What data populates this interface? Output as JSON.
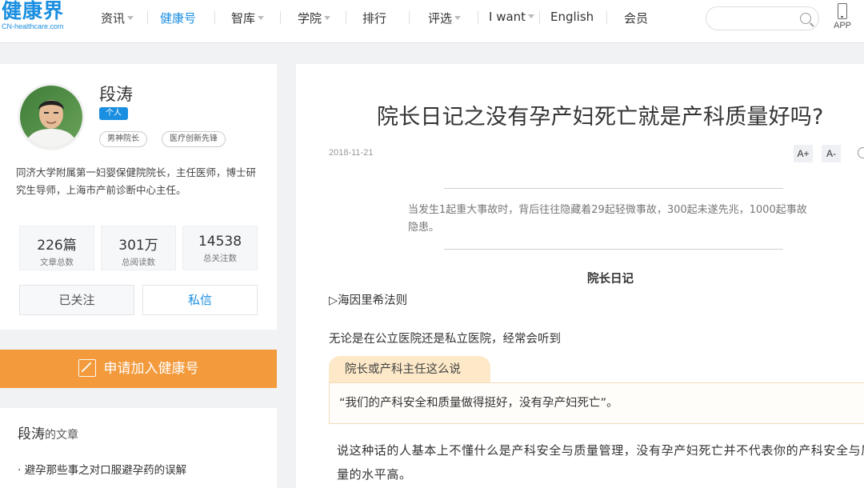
{
  "header": {
    "logo_text": "健康界",
    "logo_sub": "CN-healthcare.com",
    "nav": [
      {
        "label": "资讯",
        "dropdown": true
      },
      {
        "label": "健康号",
        "dropdown": false,
        "active": true
      },
      {
        "label": "智库",
        "dropdown": true
      },
      {
        "label": "学院",
        "dropdown": true
      },
      {
        "label": "排行",
        "dropdown": false
      },
      {
        "label": "评选",
        "dropdown": true
      },
      {
        "label": "I want",
        "dropdown": true
      },
      {
        "label": "English",
        "dropdown": false
      },
      {
        "label": "会员",
        "dropdown": false
      }
    ],
    "search_placeholder": "",
    "app_label": "APP"
  },
  "author": {
    "name": "段涛",
    "badge": "个人",
    "tags": [
      "男神院长",
      "医疗创新先锋"
    ],
    "bio": "同济大学附属第一妇婴保健院院长，主任医师，博士研究生导师，上海市产前诊断中心主任。",
    "stats": [
      {
        "value": "226篇",
        "label": "文章总数"
      },
      {
        "value": "301万",
        "label": "总阅读数"
      },
      {
        "value": "14538",
        "label": "总关注数"
      }
    ],
    "follow_label": "已关注",
    "message_label": "私信"
  },
  "join_label": "申请加入健康号",
  "articles": {
    "name": "段涛",
    "suffix": "的文章",
    "items": [
      "· 避孕那些事之对口服避孕药的误解"
    ]
  },
  "article": {
    "title": "院长日记之没有孕产妇死亡就是产科质量好吗?",
    "date": "2018-11-21",
    "font_up": "A+",
    "font_down": "A-",
    "quote": "当发生1起重大事故时，背后往往隐藏着29起轻微事故，300起未遂先兆，1000起事故隐患。",
    "subhead": "院长日记",
    "section": "▷海因里希法则",
    "para1": "无论是在公立医院还是私立医院，经常会听到",
    "callout_title": "院长或产科主任这么说",
    "callout_text": "“我们的产科安全和质量做得挺好，没有孕产妇死亡”。",
    "body": "说这种话的人基本上不懂什么是产科安全与质量管理，没有孕产妇死亡并不代表你的产科安全与质量的水平高。"
  },
  "colors": {
    "brand": "#1a8ee0",
    "join_button": "#f39a3c",
    "callout_tab": "#fde9c8"
  }
}
